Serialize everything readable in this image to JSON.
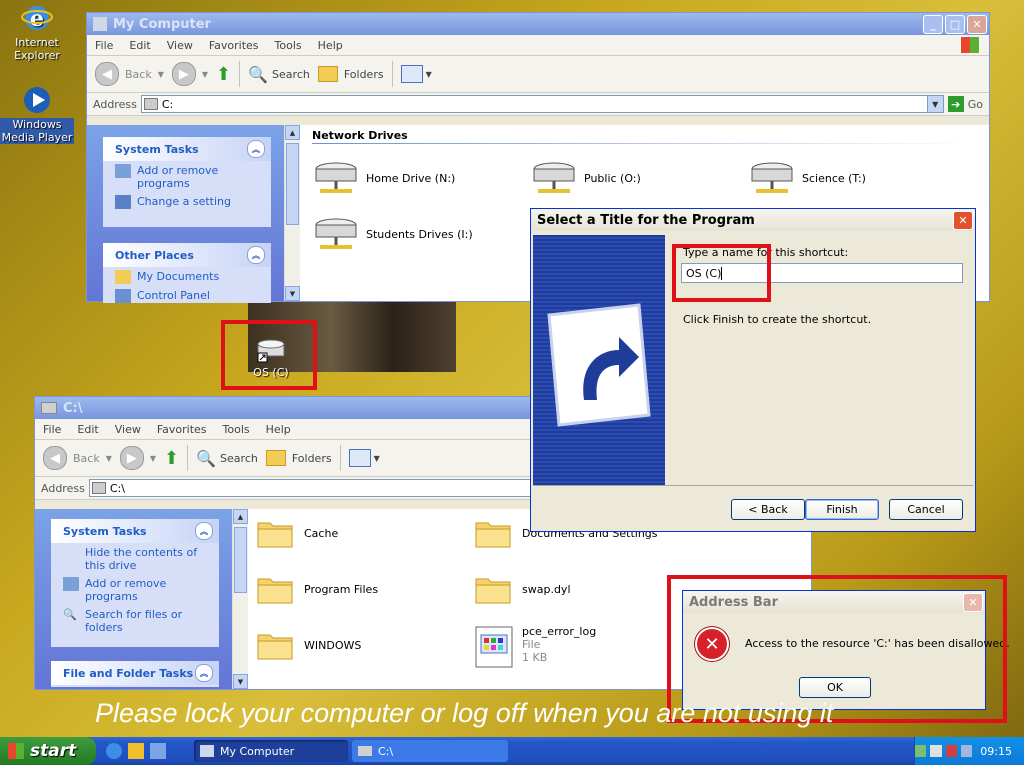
{
  "desktop": {
    "icons": [
      {
        "label": "Internet Explorer"
      },
      {
        "label": "Windows Media Player"
      },
      {
        "label": "OS (C)"
      }
    ],
    "banner": "Please lock your computer or log off when you are not using it"
  },
  "my_computer": {
    "title": "My Computer",
    "menu": [
      "File",
      "Edit",
      "View",
      "Favorites",
      "Tools",
      "Help"
    ],
    "toolbar": {
      "back": "Back",
      "search": "Search",
      "folders": "Folders"
    },
    "address_label": "Address",
    "address_value": "C:",
    "go": "Go",
    "panels": [
      {
        "title": "System Tasks",
        "items": [
          "Add or remove programs",
          "Change a setting"
        ]
      },
      {
        "title": "Other Places",
        "items": [
          "My Documents",
          "Control Panel"
        ]
      }
    ],
    "section_header": "Network Drives",
    "drives": [
      "Home Drive (N:)",
      "Public (O:)",
      "Science (T:)",
      "Students Drives (I:)"
    ]
  },
  "c_drive": {
    "title": "C:\\",
    "menu": [
      "File",
      "Edit",
      "View",
      "Favorites",
      "Tools",
      "Help"
    ],
    "toolbar": {
      "back": "Back",
      "search": "Search",
      "folders": "Folders"
    },
    "address_label": "Address",
    "address_value": "C:\\",
    "panels": [
      {
        "title": "System Tasks",
        "items": [
          "Hide the contents of this drive",
          "Add or remove programs",
          "Search for files or folders"
        ]
      },
      {
        "title": "File and Folder Tasks",
        "items": []
      }
    ],
    "items": [
      {
        "name": "Cache"
      },
      {
        "name": "Documents and Settings"
      },
      {
        "name": "Program Files"
      },
      {
        "name": "swap.dyl"
      },
      {
        "name": "WINDOWS"
      },
      {
        "name": "pce_error_log",
        "type": "File",
        "size": "1 KB"
      }
    ]
  },
  "shortcut_dialog": {
    "title": "Select a Title for the Program",
    "prompt": "Type a name for this shortcut:",
    "name_value": "OS (C)",
    "hint": "Click Finish to create the shortcut.",
    "back": "< Back",
    "finish": "Finish",
    "cancel": "Cancel"
  },
  "error_dialog": {
    "title": "Address Bar",
    "message": "Access to the resource 'C:' has been disallowed.",
    "ok": "OK"
  },
  "taskbar": {
    "start": "start",
    "tasks": [
      "My Computer",
      "C:\\"
    ],
    "clock": "09:15"
  },
  "colors": {
    "highlight": "#e01018",
    "xp_blue": "#0a5fd8",
    "link_blue": "#215dc6"
  }
}
